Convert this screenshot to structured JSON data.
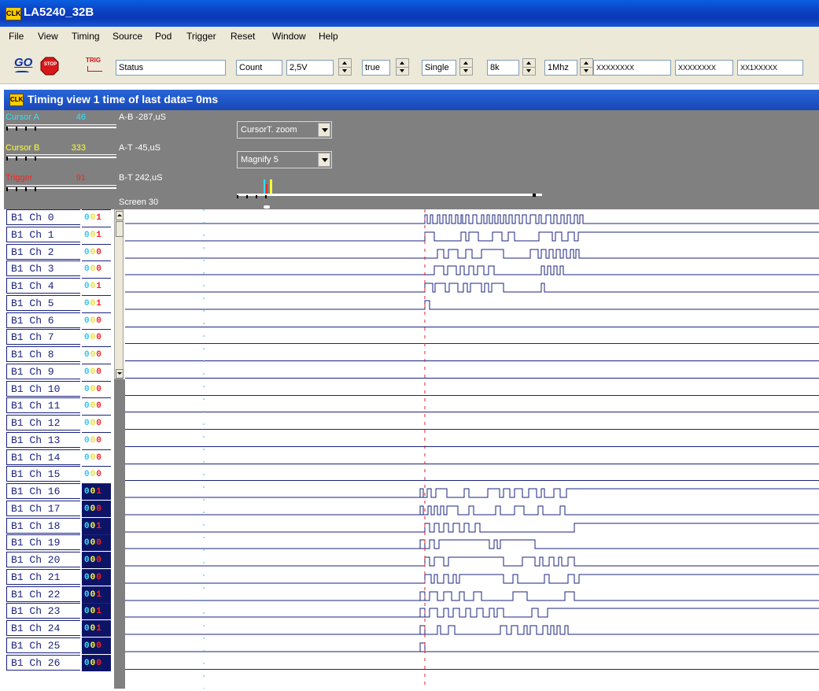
{
  "window": {
    "title": "LA5240_32B",
    "logo_text": "CLK"
  },
  "menu": [
    "File",
    "View",
    "Timing",
    "Source",
    "Pod",
    "Trigger",
    "Reset",
    "Window",
    "Help"
  ],
  "toolbar": {
    "go_label": "GO",
    "stop_label": "STOP",
    "trig_label": "TRIG",
    "status": "Status",
    "count": "Count",
    "voltage": "2,5V",
    "mode_bool": "true",
    "capture_mode": "Single",
    "depth": "8k",
    "frequency": "1Mhz",
    "pattern1": "XXXXXXXX",
    "pattern2": "XXXXXXXX",
    "pattern3": "XX1XXXXX"
  },
  "view": {
    "title": "Timing view  1    time of last data= 0ms"
  },
  "cursors": {
    "a": {
      "label": "Cursor A",
      "value": "46",
      "color": "#33e0ff"
    },
    "b": {
      "label": "Cursor B",
      "value": "333",
      "color": "#ffff33"
    },
    "t": {
      "label": "Trigger",
      "value": "91",
      "color": "#ff2020"
    }
  },
  "measurements": {
    "ab": "A-B  -287,uS",
    "at": "A-T  -45,uS",
    "bt": "B-T  242,uS",
    "screen": "Screen  30"
  },
  "zoom": {
    "cursor_mode": "CursorT. zoom",
    "magnify": "Magnify 5"
  },
  "channels": [
    {
      "name": "B1 Ch 0",
      "state": "001"
    },
    {
      "name": "B1 Ch 1",
      "state": "001"
    },
    {
      "name": "B1 Ch 2",
      "state": "000"
    },
    {
      "name": "B1 Ch 3",
      "state": "000"
    },
    {
      "name": "B1 Ch 4",
      "state": "001"
    },
    {
      "name": "B1 Ch 5",
      "state": "001"
    },
    {
      "name": "B1 Ch 6",
      "state": "000"
    },
    {
      "name": "B1 Ch 7",
      "state": "000"
    },
    {
      "name": "B1 Ch 8",
      "state": "000"
    },
    {
      "name": "B1 Ch 9",
      "state": "000"
    },
    {
      "name": "B1 Ch 10",
      "state": "000"
    },
    {
      "name": "B1 Ch 11",
      "state": "000"
    },
    {
      "name": "B1 Ch 12",
      "state": "000"
    },
    {
      "name": "B1 Ch 13",
      "state": "000"
    },
    {
      "name": "B1 Ch 14",
      "state": "000"
    },
    {
      "name": "B1 Ch 15",
      "state": "000"
    },
    {
      "name": "B1 Ch 16",
      "state": "001"
    },
    {
      "name": "B1 Ch 17",
      "state": "000"
    },
    {
      "name": "B1 Ch 18",
      "state": "001"
    },
    {
      "name": "B1 Ch 19",
      "state": "000"
    },
    {
      "name": "B1 Ch 20",
      "state": "000"
    },
    {
      "name": "B1 Ch 21",
      "state": "000"
    },
    {
      "name": "B1 Ch 22",
      "state": "001"
    },
    {
      "name": "B1 Ch 23",
      "state": "001"
    },
    {
      "name": "B1 Ch 24",
      "state": "001"
    },
    {
      "name": "B1 Ch 25",
      "state": "000"
    },
    {
      "name": "B1 Ch 26",
      "state": "000"
    }
  ],
  "colors": {
    "wave": "#1a237e",
    "state_bg_bank2": "#0d1466"
  }
}
